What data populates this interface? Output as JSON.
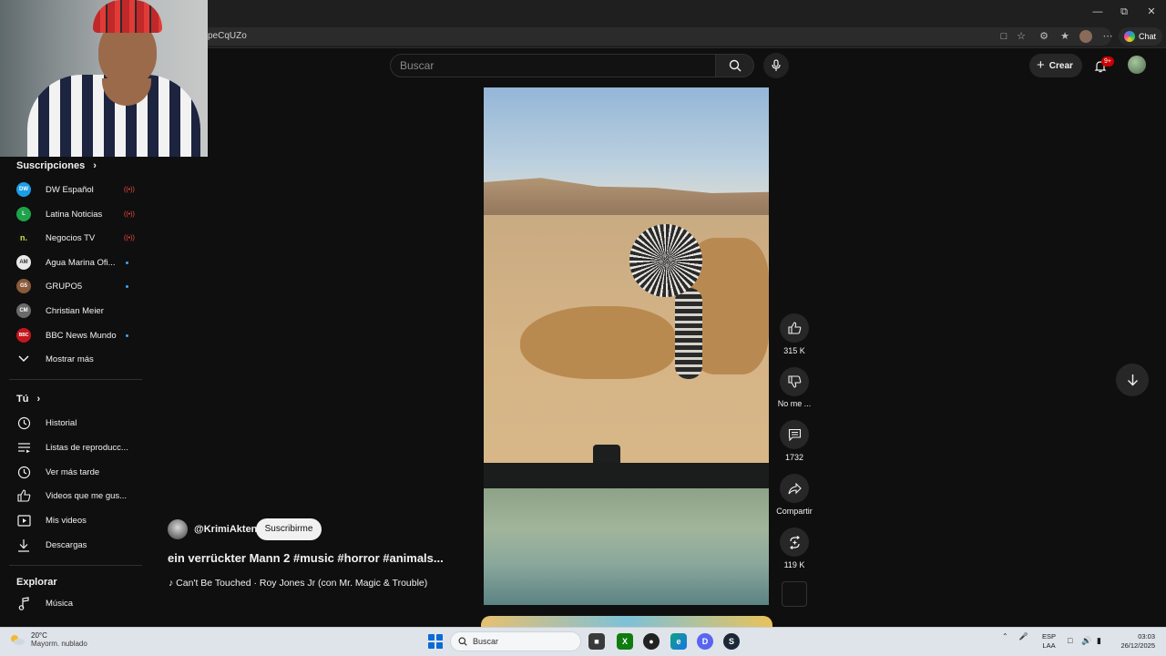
{
  "browser": {
    "url_fragment": "peCqUZo",
    "chat_label": "Chat"
  },
  "header": {
    "search_placeholder": "Buscar",
    "create_label": "Crear",
    "notifications_badge": "9+"
  },
  "sidebar": {
    "subscriptions_title": "Suscripciones",
    "subscriptions": [
      {
        "label": "DW Español",
        "status": "live",
        "initials": "DW",
        "color": "#1a9ee8"
      },
      {
        "label": "Latina Noticias",
        "status": "live",
        "initials": "L",
        "color": "#1fa34a"
      },
      {
        "label": "Negocios TV",
        "status": "live",
        "initials": "n.",
        "color": "#111111"
      },
      {
        "label": "Agua Marina Ofi...",
        "status": "new",
        "initials": "AM",
        "color": "#e9e9e9"
      },
      {
        "label": "GRUPO5",
        "status": "new",
        "initials": "G5",
        "color": "#8a5a3a"
      },
      {
        "label": "Christian Meier",
        "status": "",
        "initials": "CM",
        "color": "#6a6a6a"
      },
      {
        "label": "BBC News Mundo",
        "status": "new",
        "initials": "BBC",
        "color": "#c4161c"
      }
    ],
    "show_more": "Mostrar más",
    "you_title": "Tú",
    "you_items": [
      {
        "label": "Historial",
        "icon": "history-icon"
      },
      {
        "label": "Listas de reproducc...",
        "icon": "playlist-icon"
      },
      {
        "label": "Ver más tarde",
        "icon": "clock-icon"
      },
      {
        "label": "Videos que me gus...",
        "icon": "thumbs-up-icon"
      },
      {
        "label": "Mis videos",
        "icon": "video-icon"
      },
      {
        "label": "Descargas",
        "icon": "download-icon"
      }
    ],
    "explore_title": "Explorar",
    "explore_items": [
      {
        "label": "Música",
        "icon": "music-icon"
      }
    ]
  },
  "short": {
    "channel": "@KrimiAkten",
    "subscribe_label": "Suscribirme",
    "title": "ein verrückter Mann 2 #music #horror #animals...",
    "sound": "Can't Be Touched · Roy Jones Jr (con Mr. Magic & Trouble)",
    "likes": "315 K",
    "dislike_label": "No me ...",
    "comments": "1732",
    "share_label": "Compartir",
    "remix_count": "119 K"
  },
  "taskbar": {
    "temp": "20°C",
    "weather": "Mayorm. nublado",
    "search_label": "Buscar",
    "lang_line1": "ESP",
    "lang_line2": "LAA",
    "time": "03:03",
    "date": "26/12/2025"
  }
}
